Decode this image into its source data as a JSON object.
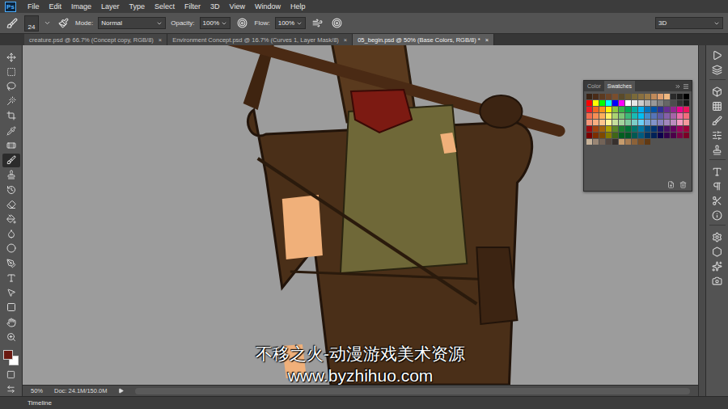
{
  "app": {
    "logo": "Ps"
  },
  "menu": [
    "File",
    "Edit",
    "Image",
    "Layer",
    "Type",
    "Select",
    "Filter",
    "3D",
    "View",
    "Window",
    "Help"
  ],
  "options": {
    "brush_size": "24",
    "mode_label": "Mode:",
    "mode": "Normal",
    "opacity_label": "Opacity:",
    "opacity": "100%",
    "flow_label": "Flow:",
    "flow": "100%",
    "workspace": "3D"
  },
  "tabs": [
    {
      "label": "creature.psd @ 66.7% (Concept copy, RGB/8)",
      "close": "×",
      "selected": false
    },
    {
      "label": "Environment Concept.psd @ 16.7% (Curves 1, Layer Mask/8)",
      "close": "×",
      "selected": false
    },
    {
      "label": "05_begin.psd @ 50% (Base Colors, RGB/8) *",
      "close": "×",
      "selected": true
    }
  ],
  "tools": [
    {
      "selected": false
    },
    {
      "selected": false
    },
    {
      "selected": false
    },
    {
      "selected": false
    },
    {
      "selected": false
    },
    {
      "selected": false
    },
    {
      "selected": false
    },
    {
      "selected": true
    },
    {
      "selected": false
    },
    {
      "selected": false
    },
    {
      "selected": false
    },
    {
      "selected": false
    },
    {
      "selected": false
    },
    {
      "selected": false
    },
    {
      "selected": false
    },
    {
      "selected": false
    },
    {
      "selected": false
    },
    {
      "selected": false
    },
    {
      "selected": false
    },
    {
      "selected": false
    }
  ],
  "color_chips": {
    "foreground": "#6b1a12",
    "background": "#ffffff"
  },
  "swatches_panel": {
    "tabs": [
      {
        "label": "Color",
        "selected": false
      },
      {
        "label": "Swatches",
        "selected": true
      }
    ],
    "swatches": [
      "#3a2314",
      "#4a2c18",
      "#5c3a20",
      "#6b4428",
      "#7a4e2e",
      "#5a4a2a",
      "#6a5a30",
      "#7a6a3a",
      "#8a7040",
      "#9a7a48",
      "#c08a5a",
      "#e0a070",
      "#f0b880",
      "#2a2a2a",
      "#1a1a1a",
      "#000000",
      "#ff0000",
      "#ffff00",
      "#00ff00",
      "#00ffff",
      "#0000ff",
      "#ff00ff",
      "#ffffff",
      "#e6e6e6",
      "#cccccc",
      "#b3b3b3",
      "#999999",
      "#808080",
      "#666666",
      "#4d4d4d",
      "#333333",
      "#1a1a1a",
      "#ed1c24",
      "#f26522",
      "#f7941d",
      "#fff200",
      "#8dc63f",
      "#39b54a",
      "#00a651",
      "#00a99d",
      "#00aeef",
      "#0072bc",
      "#0054a6",
      "#2e3192",
      "#662d91",
      "#92278f",
      "#ec008c",
      "#ed145b",
      "#f26c4f",
      "#f68e55",
      "#fbaf5c",
      "#fff467",
      "#acd372",
      "#7cc576",
      "#3bb878",
      "#1abbb4",
      "#00bff3",
      "#438ccb",
      "#5574b9",
      "#605ca8",
      "#855fa8",
      "#a763a8",
      "#f06ea9",
      "#f26d7d",
      "#f7977a",
      "#f9ad81",
      "#fdc68c",
      "#fff799",
      "#c6df9c",
      "#a4d49d",
      "#81ca9d",
      "#7bcdc8",
      "#6ccff7",
      "#7ca6d8",
      "#8293ca",
      "#8881be",
      "#a286bd",
      "#bc8cbf",
      "#f49bc1",
      "#f5989d",
      "#9e0b0f",
      "#a0410d",
      "#a36209",
      "#aba000",
      "#598527",
      "#1a7b30",
      "#007236",
      "#00746b",
      "#0076a3",
      "#004b80",
      "#003471",
      "#1b1464",
      "#440e62",
      "#630460",
      "#9e005d",
      "#9e0039",
      "#790000",
      "#7b2e00",
      "#7d4900",
      "#827b00",
      "#406618",
      "#005e20",
      "#005826",
      "#005952",
      "#005b7f",
      "#003663",
      "#002157",
      "#0d004c",
      "#32004b",
      "#4b0049",
      "#7b0046",
      "#7a0026",
      "#c7b299",
      "#998675",
      "#736357",
      "#534741",
      "#37302d",
      "#c69c6d",
      "#a67c52",
      "#8c6239",
      "#754c24",
      "#603913"
    ]
  },
  "status_bar": {
    "zoom": "50%",
    "doc": "Doc: 24.1M/150.0M"
  },
  "timeline": {
    "label": "Timeline"
  },
  "watermark": {
    "line1": "不移之火-动漫游戏美术资源",
    "line2": "www.byzhihuo.com"
  }
}
